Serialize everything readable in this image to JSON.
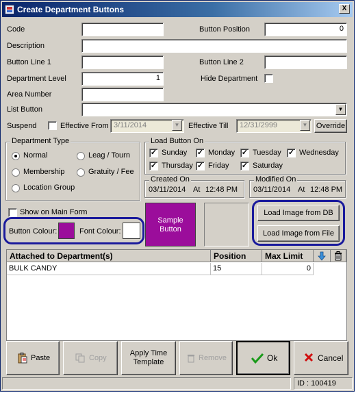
{
  "window": {
    "title": "Create Department Buttons",
    "close": "X"
  },
  "fields": {
    "code": {
      "label": "Code",
      "value": ""
    },
    "button_position": {
      "label": "Button Position",
      "value": "0"
    },
    "description": {
      "label": "Description",
      "value": ""
    },
    "button_line1": {
      "label": "Button Line 1",
      "value": ""
    },
    "button_line2": {
      "label": "Button Line 2",
      "value": ""
    },
    "department_level": {
      "label": "Department Level",
      "value": "1"
    },
    "hide_department": {
      "label": "Hide Department",
      "checked": false
    },
    "area_number": {
      "label": "Area Number",
      "value": ""
    },
    "list_button": {
      "label": "List Button",
      "value": ""
    },
    "suspend": {
      "label": "Suspend",
      "checked": false
    },
    "effective_from": {
      "label": "Effective From",
      "value": "3/11/2014"
    },
    "effective_till": {
      "label": "Effective Till",
      "value": "12/31/2999"
    },
    "override_label": "Override"
  },
  "department_type": {
    "title": "Department Type",
    "options": [
      {
        "label": "Normal",
        "selected": true
      },
      {
        "label": "Leag / Tourn",
        "selected": false
      },
      {
        "label": "Membership",
        "selected": false
      },
      {
        "label": "Gratuity / Fee",
        "selected": false
      },
      {
        "label": "Location Group",
        "selected": false
      }
    ]
  },
  "load_button_on": {
    "title": "Load Button On",
    "days": [
      {
        "label": "Sunday",
        "checked": true
      },
      {
        "label": "Monday",
        "checked": true
      },
      {
        "label": "Tuesday",
        "checked": true
      },
      {
        "label": "Wednesday",
        "checked": true
      },
      {
        "label": "Thursday",
        "checked": true
      },
      {
        "label": "Friday",
        "checked": true
      },
      {
        "label": "Saturday",
        "checked": true
      }
    ]
  },
  "created_on": {
    "title": "Created On",
    "date": "03/11/2014",
    "at": "At",
    "time": "12:48 PM"
  },
  "modified_on": {
    "title": "Modified On",
    "date": "03/11/2014",
    "at": "At",
    "time": "12:48 PM"
  },
  "show_on_main_form": {
    "label": "Show on Main Form",
    "checked": false
  },
  "colours": {
    "button_label": "Button Colour:",
    "button_colour": "#9b0d9b",
    "font_label": "Font Colour:",
    "font_colour": "#ffffff"
  },
  "sample_button": {
    "line1": "Sample",
    "line2": "Button",
    "bg": "#9b0d9b",
    "fg": "#ffffff"
  },
  "image_buttons": {
    "load_db": "Load Image from DB",
    "load_file": "Load Image from File"
  },
  "grid": {
    "headers": {
      "department": "Attached to Department(s)",
      "position": "Position",
      "max_limit": "Max Limit"
    },
    "rows": [
      {
        "department": "BULK CANDY",
        "position": "15",
        "max_limit": "0"
      }
    ]
  },
  "bottom_buttons": {
    "paste": "Paste",
    "copy": "Copy",
    "apply_time_template_line1": "Apply Time",
    "apply_time_template_line2": "Template",
    "remove": "Remove",
    "ok": "Ok",
    "cancel": "Cancel"
  },
  "status": {
    "id": "ID : 100419"
  },
  "colors": {
    "highlight_oval": "#1a1a9c",
    "title_bar": "#0a246a"
  }
}
